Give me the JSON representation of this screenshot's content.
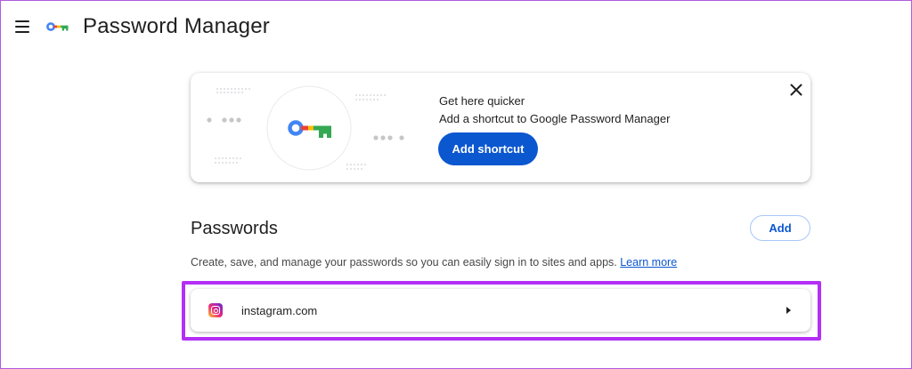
{
  "header": {
    "title": "Password Manager",
    "menu_icon": "hamburger-menu-icon",
    "logo_icon": "google-key-icon"
  },
  "promo": {
    "heading": "Get here quicker",
    "description": "Add a shortcut to Google Password Manager",
    "button_label": "Add shortcut",
    "close_icon": "close-icon",
    "illustration_icon": "google-key-icon"
  },
  "passwords": {
    "title": "Passwords",
    "add_label": "Add",
    "description": "Create, save, and manage your passwords so you can easily sign in to sites and apps.",
    "learn_more": "Learn more",
    "items": [
      {
        "site": "instagram.com",
        "icon": "instagram-icon"
      }
    ]
  },
  "colors": {
    "accent": "#0b57d0",
    "highlight": "#b42ff5",
    "key_blue": "#4285f4",
    "key_red": "#ea4335",
    "key_yellow": "#fbbc04",
    "key_green": "#34a853"
  }
}
